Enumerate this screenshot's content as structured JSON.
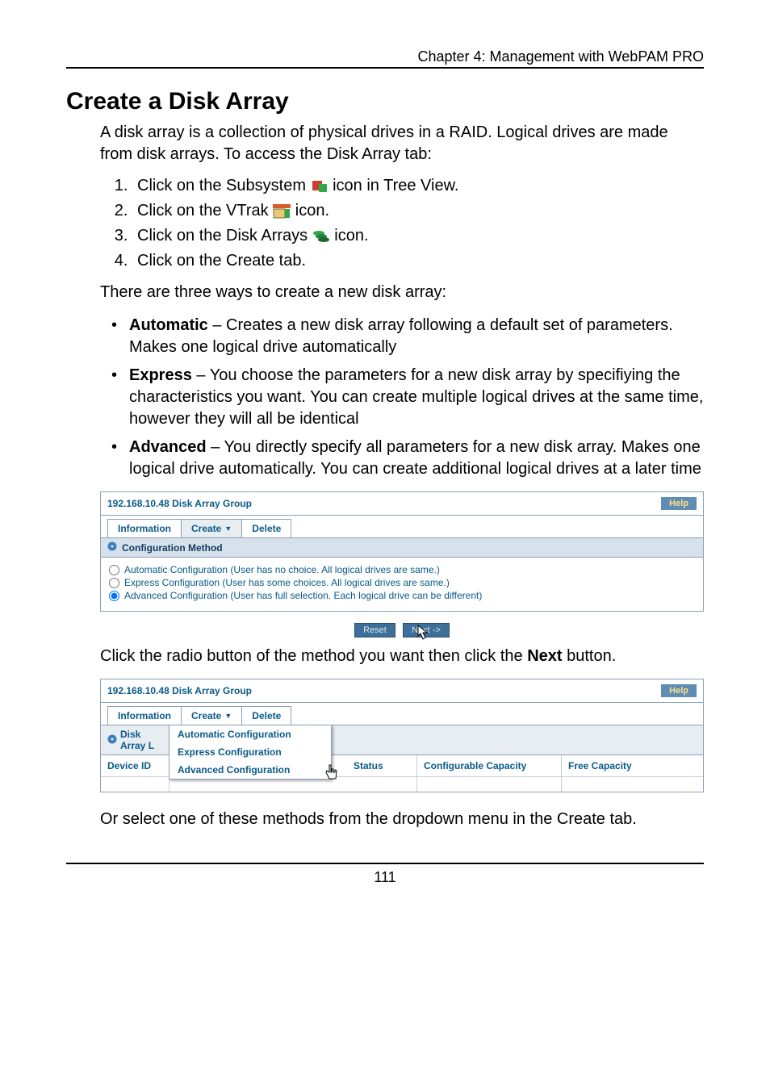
{
  "chapter": "Chapter 4: Management with WebPAM PRO",
  "heading": "Create a Disk Array",
  "intro": "A disk array is a collection of physical drives in a RAID. Logical drives are made from disk arrays. To access the Disk Array tab:",
  "steps": {
    "s1a": "Click on the Subsystem ",
    "s1b": " icon in Tree View.",
    "s2a": "Click on the VTrak ",
    "s2b": " icon.",
    "s3a": "Click on the Disk Arrays ",
    "s3b": " icon.",
    "s4": "Click on the Create tab."
  },
  "methods_intro": "There are three ways to create a new disk array:",
  "bullets": {
    "b1_label": "Automatic",
    "b1_text": " – Creates a new disk array following a default set of parameters. Makes one logical drive automatically",
    "b2_label": "Express",
    "b2_text": " – You choose the parameters for a new disk array by specifiying the characteristics you want. You can create multiple logical drives at the same time, however they will all be identical",
    "b3_label": "Advanced",
    "b3_text": " – You directly specify all parameters for a new disk array. Makes one logical drive automatically. You can create additional logical drives at a later time"
  },
  "panel1": {
    "title": "192.168.10.48 Disk Array Group",
    "help": "Help",
    "tabs": {
      "info": "Information",
      "create": "Create",
      "delete": "Delete"
    },
    "section": "Configuration Method",
    "radio_auto": "Automatic Configuration (User has no choice. All logical drives are same.)",
    "radio_express": "Express Configuration (User has some choices. All logical drives are same.)",
    "radio_advanced": "Advanced Configuration (User has full selection. Each logical drive can be different)",
    "reset": "Reset",
    "next": "Next ->"
  },
  "mid_text_a": "Click the radio button of the method you want then click the ",
  "mid_text_bold": "Next",
  "mid_text_b": " button.",
  "panel2": {
    "title": "192.168.10.48 Disk Array Group",
    "help": "Help",
    "tabs": {
      "info": "Information",
      "create": "Create",
      "delete": "Delete"
    },
    "list_label": "Disk Array L",
    "cols": {
      "device": "Device ID",
      "status": "Status",
      "cap": "Configurable Capacity",
      "free": "Free Capacity"
    },
    "menu": {
      "auto": "Automatic Configuration",
      "express": "Express Configuration",
      "adv": "Advanced Configuration"
    }
  },
  "closing": "Or select one of these methods from the dropdown menu in the Create tab.",
  "page_number": "111"
}
